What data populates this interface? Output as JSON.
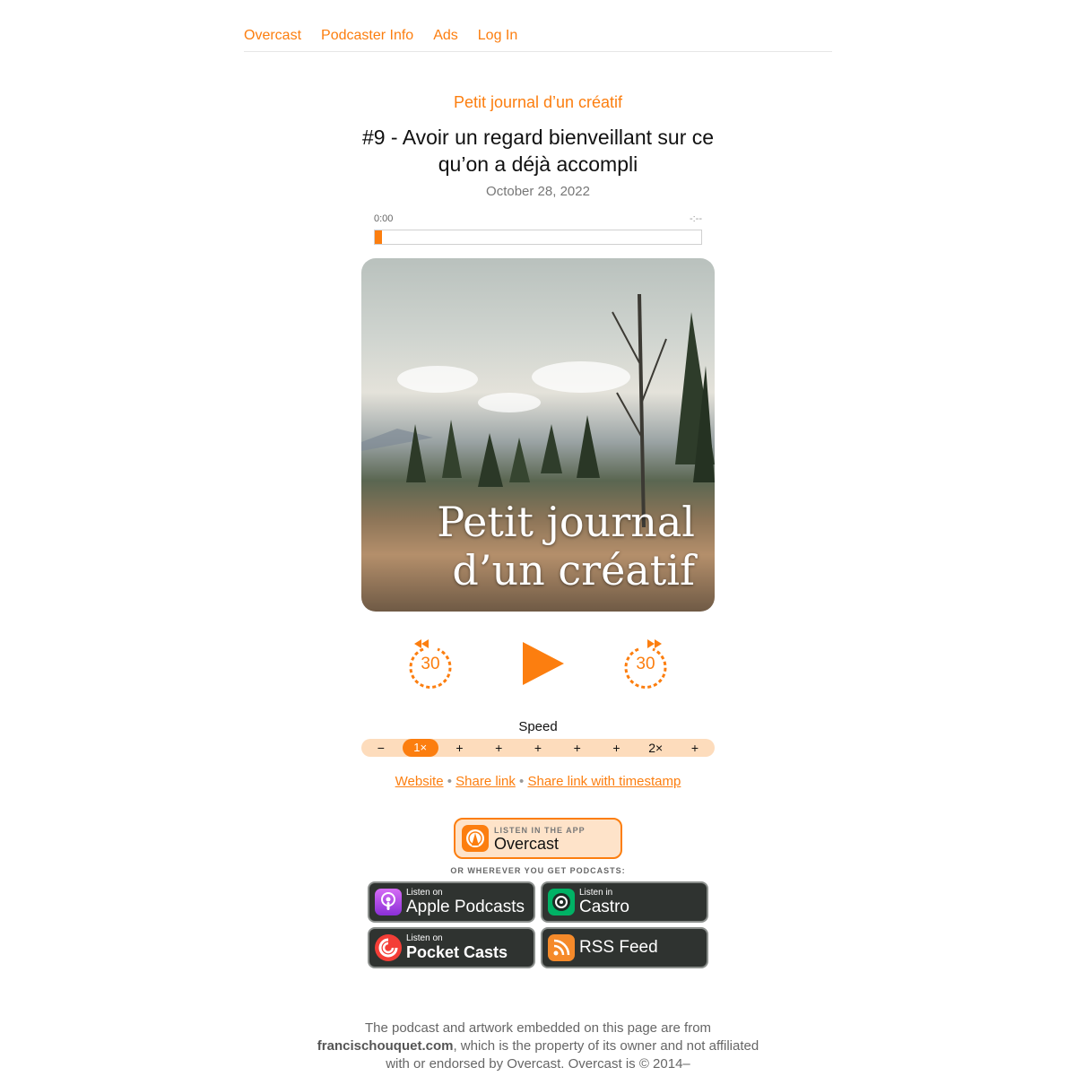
{
  "nav": {
    "items": [
      "Overcast",
      "Podcaster Info",
      "Ads",
      "Log In"
    ]
  },
  "podcast_title": "Petit journal d’un créatif",
  "episode": {
    "title": "#9 - Avoir un regard bienveillant sur ce qu’on a déjà accompli",
    "date": "October 28, 2022"
  },
  "player": {
    "time_start": "0:00",
    "time_end": "-:--",
    "progress_fraction": 0.02,
    "skip_back_label": "30",
    "skip_forward_label": "30"
  },
  "artwork": {
    "text_line1": "Petit journal",
    "text_line2": "d’un créatif"
  },
  "speed": {
    "label": "Speed",
    "items": [
      "−",
      "1×",
      "+",
      "+",
      "+",
      "+",
      "+",
      "2×",
      "+"
    ],
    "active_index": 1
  },
  "links": {
    "website": "Website",
    "share": "Share link",
    "share_timestamp": "Share link with timestamp",
    "separator": "•"
  },
  "overcast_badge": {
    "sub": "LISTEN IN THE APP",
    "main": "Overcast"
  },
  "or_text": "OR WHEREVER YOU GET PODCASTS:",
  "badges": {
    "apple": {
      "sub": "Listen on",
      "main": "Apple Podcasts"
    },
    "castro": {
      "sub": "Listen in",
      "main": "Castro"
    },
    "pocket": {
      "sub": "Listen on",
      "main": "Pocket Casts"
    },
    "rss": {
      "main": "RSS Feed"
    }
  },
  "footer": {
    "line1": "The podcast and artwork embedded on this page are from",
    "domain": "francischouquet.com",
    "line2": ", which is the property of its owner and not affiliated with or endorsed by Overcast. Overcast is © 2014–"
  },
  "colors": {
    "accent": "#fc7e0f",
    "speed_bg": "#fddcbc",
    "badge_dark": "#2f3330"
  }
}
